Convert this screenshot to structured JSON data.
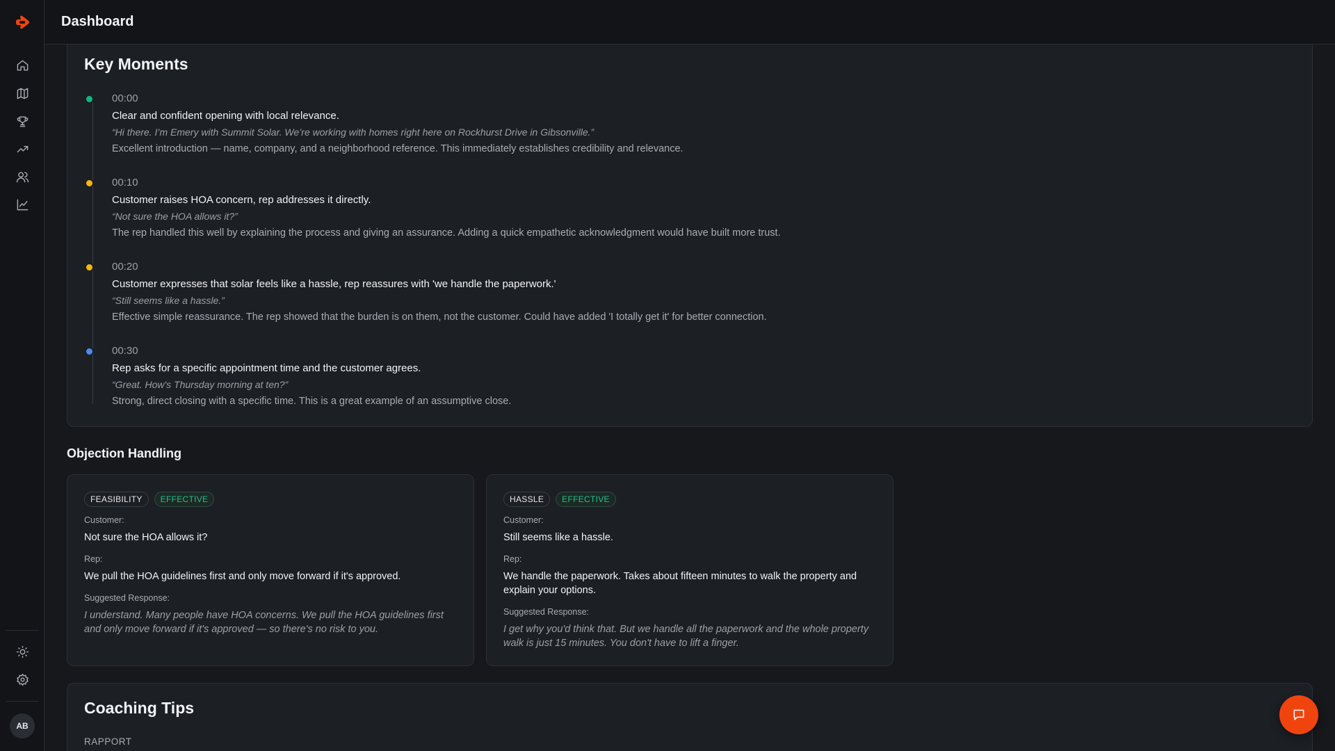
{
  "header": {
    "title": "Dashboard"
  },
  "sidebar": {
    "nav": [
      {
        "icon": "home-icon"
      },
      {
        "icon": "map-icon"
      },
      {
        "icon": "trophy-icon"
      },
      {
        "icon": "trending-up-icon"
      },
      {
        "icon": "users-icon"
      },
      {
        "icon": "line-chart-icon"
      }
    ],
    "bottom": [
      {
        "icon": "sun-icon"
      },
      {
        "icon": "gear-icon"
      }
    ],
    "avatar_initials": "AB"
  },
  "colors": {
    "accent": "#f0440f",
    "effective": "#22c08a",
    "dot_green": "#10b981",
    "dot_amber": "#f5b70a",
    "dot_blue": "#4a8cf0"
  },
  "key_moments": {
    "title": "Key Moments",
    "items": [
      {
        "time": "00:00",
        "status_color": "#10b981",
        "title": "Clear and confident opening with local relevance.",
        "quote": "“Hi there. I’m Emery with Summit Solar. We’re working with homes right here on Rockhurst Drive in Gibsonville.”",
        "note": "Excellent introduction — name, company, and a neighborhood reference. This immediately establishes credibility and relevance."
      },
      {
        "time": "00:10",
        "status_color": "#f5b70a",
        "title": "Customer raises HOA concern, rep addresses it directly.",
        "quote": "“Not sure the HOA allows it?”",
        "note": "The rep handled this well by explaining the process and giving an assurance. Adding a quick empathetic acknowledgment would have built more trust."
      },
      {
        "time": "00:20",
        "status_color": "#f5b70a",
        "title": "Customer expresses that solar feels like a hassle, rep reassures with 'we handle the paperwork.'",
        "quote": "“Still seems like a hassle.”",
        "note": "Effective simple reassurance. The rep showed that the burden is on them, not the customer. Could have added 'I totally get it' for better connection."
      },
      {
        "time": "00:30",
        "status_color": "#4a8cf0",
        "title": "Rep asks for a specific appointment time and the customer agrees.",
        "quote": "“Great. How's Thursday morning at ten?”",
        "note": "Strong, direct closing with a specific time. This is a great example of an assumptive close."
      }
    ]
  },
  "objection_handling": {
    "title": "Objection Handling",
    "labels": {
      "customer": "Customer:",
      "rep": "Rep:",
      "suggested": "Suggested Response:"
    },
    "cards": [
      {
        "category": "FEASIBILITY",
        "result": "EFFECTIVE",
        "customer": "Not sure the HOA allows it?",
        "rep": "We pull the HOA guidelines first and only move forward if it's approved.",
        "suggested": "I understand. Many people have HOA concerns. We pull the HOA guidelines first and only move forward if it's approved — so there's no risk to you."
      },
      {
        "category": "HASSLE",
        "result": "EFFECTIVE",
        "customer": "Still seems like a hassle.",
        "rep": "We handle the paperwork. Takes about fifteen minutes to walk the property and explain your options.",
        "suggested": "I get why you'd think that. But we handle all the paperwork and the whole property walk is just 15 minutes. You don't have to lift a finger."
      }
    ]
  },
  "coaching_tips": {
    "title": "Coaching Tips",
    "first_category": "RAPPORT"
  },
  "chat_button": {
    "icon": "chat-icon"
  }
}
